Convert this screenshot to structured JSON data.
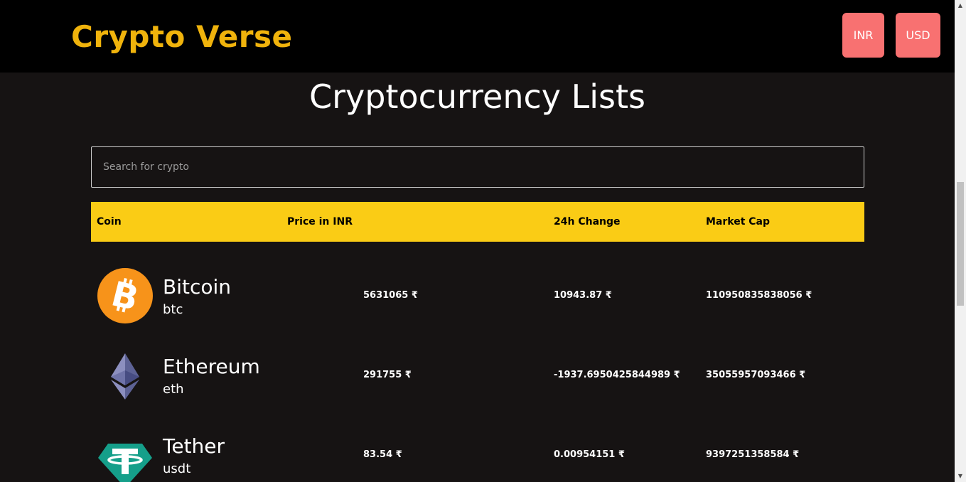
{
  "colors": {
    "brand": "#f0b30c",
    "header_bg": "#facc15",
    "button_bg": "#f87171",
    "page_bg": "#161313"
  },
  "navbar": {
    "brand": "Crypto Verse",
    "currency_buttons": [
      "INR",
      "USD"
    ]
  },
  "heading": "Cryptocurrency Lists",
  "search": {
    "placeholder": "Search for crypto",
    "value": ""
  },
  "table": {
    "columns": [
      "Coin",
      "Price in INR",
      "24h Change",
      "Market Cap"
    ],
    "rows": [
      {
        "name": "Bitcoin",
        "symbol": "btc",
        "icon": "bitcoin-icon",
        "price": "5631065 ₹",
        "change": "10943.87 ₹",
        "market_cap": "110950835838056 ₹"
      },
      {
        "name": "Ethereum",
        "symbol": "eth",
        "icon": "ethereum-icon",
        "price": "291755 ₹",
        "change": "-1937.6950425844989 ₹",
        "market_cap": "35055957093466 ₹"
      },
      {
        "name": "Tether",
        "symbol": "usdt",
        "icon": "tether-icon",
        "price": "83.54 ₹",
        "change": "0.00954151 ₹",
        "market_cap": "9397251358584 ₹"
      }
    ]
  }
}
